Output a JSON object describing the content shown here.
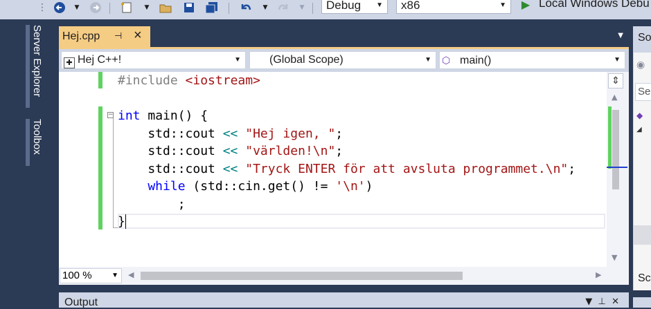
{
  "toolbar": {
    "config": "Debug",
    "platform": "x86",
    "run_target": "Local Windows Debu"
  },
  "sidebar": {
    "tab1": "Server Explorer",
    "tab2": "Toolbox"
  },
  "document": {
    "tab_title": "Hej.cpp",
    "project_combo": "Hej C++!",
    "scope_combo": "(Global Scope)",
    "member_combo": "main()"
  },
  "code": {
    "line1_pp": "#include ",
    "line1_inc": "<iostream>",
    "line3_kw": "int",
    "line3_rest": " main() {",
    "line4_a": "    std::cout ",
    "line4_op": "<<",
    "line4_str": "\"Hej igen, \"",
    "line4_end": ";",
    "line5_a": "    std::cout ",
    "line5_op": "<<",
    "line5_str": "\"världen!\\n\"",
    "line5_end": ";",
    "line6_a": "    std::cout ",
    "line6_op": "<<",
    "line6_str": "\"Tryck ENTER för att avsluta programmet.\\n\"",
    "line6_end": ";",
    "line7_kw": "    while",
    "line7_a": " (std::cin.get() != ",
    "line7_str": "'\\n'",
    "line7_end": ")",
    "line8": "        ;",
    "line9": "}"
  },
  "editor": {
    "zoom": "100 %"
  },
  "output": {
    "title": "Output"
  },
  "right_panel": {
    "title": "So",
    "search": "Se",
    "bottom": "Sc"
  }
}
